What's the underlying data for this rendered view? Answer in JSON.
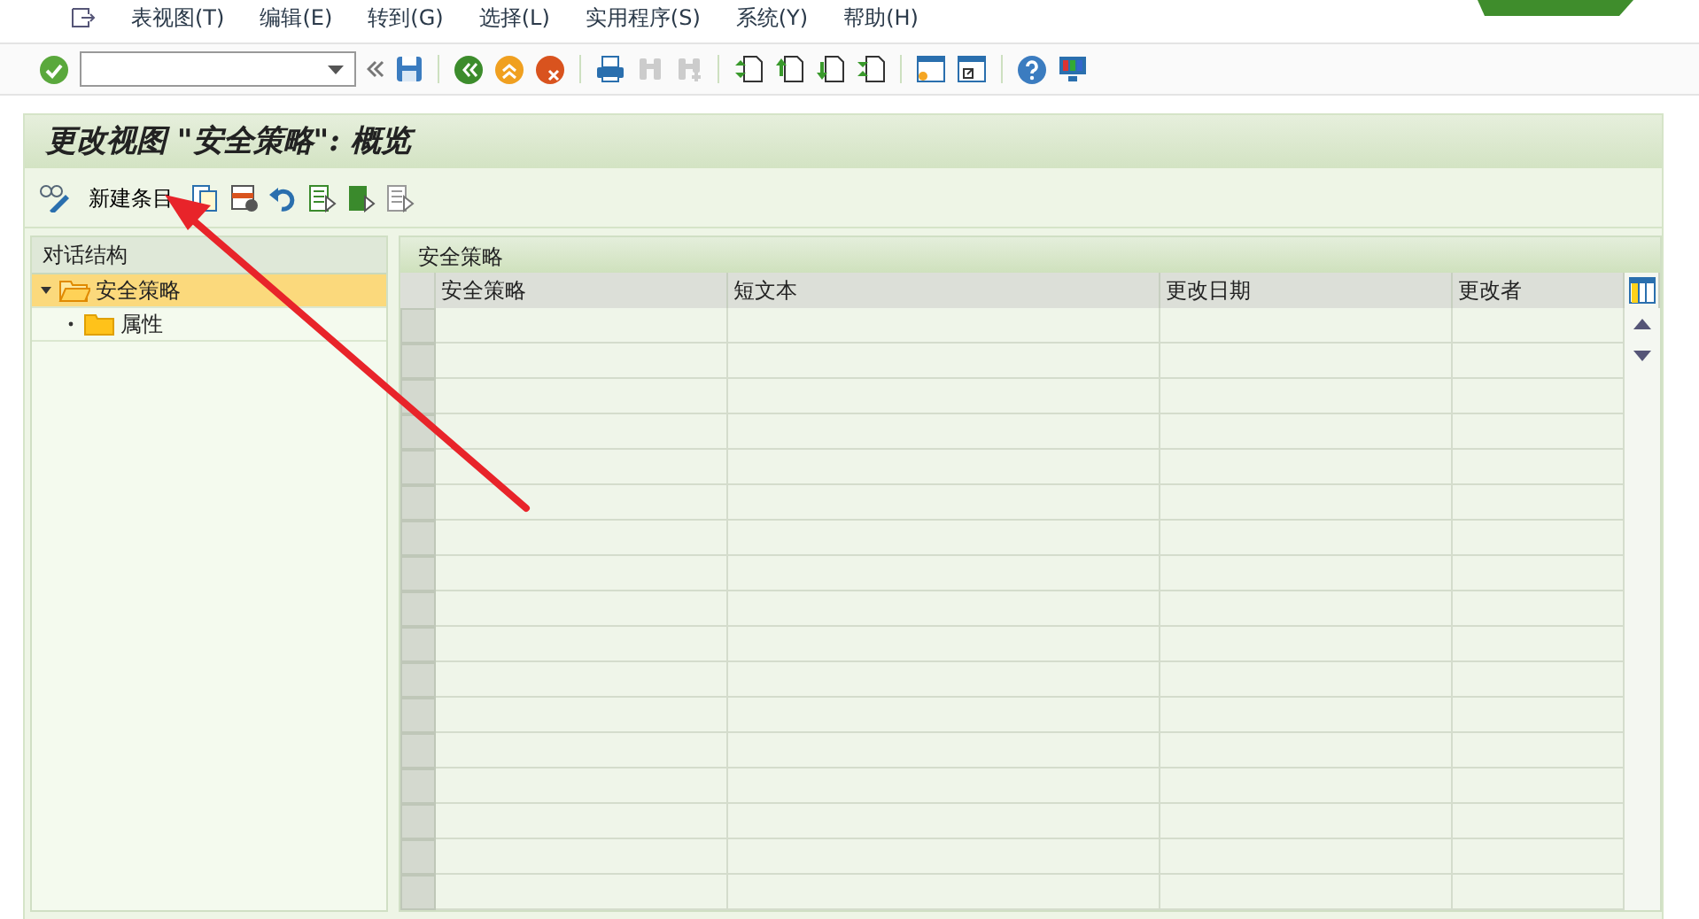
{
  "menu": [
    "表视图(T)",
    "编辑(E)",
    "转到(G)",
    "选择(L)",
    "实用程序(S)",
    "系统(Y)",
    "帮助(H)"
  ],
  "title": "更改视图 \"安全策略\": 概览",
  "app_toolbar": {
    "new_entries": "新建条目"
  },
  "tree": {
    "header": "对话结构",
    "items": [
      {
        "label": "安全策略",
        "expanded": true,
        "selected": true,
        "children": [
          {
            "label": "属性",
            "selected": false
          }
        ]
      }
    ]
  },
  "table": {
    "title": "安全策略",
    "columns": [
      "安全策略",
      "短文本",
      "更改日期",
      "更改者"
    ]
  }
}
